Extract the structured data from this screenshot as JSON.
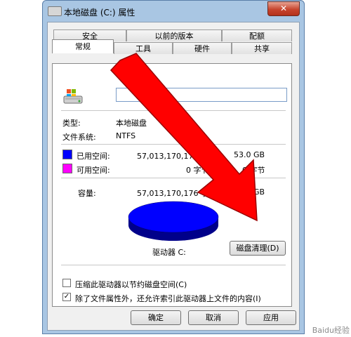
{
  "window": {
    "title": "本地磁盘 (C:) 属性",
    "close_glyph": "✕"
  },
  "tabs": {
    "row1": [
      "安全",
      "以前的版本",
      "配额"
    ],
    "row2": [
      "常规",
      "工具",
      "硬件",
      "共享"
    ]
  },
  "general": {
    "name_value": "",
    "type_label": "类型:",
    "type_value": "本地磁盘",
    "fs_label": "文件系统:",
    "fs_value": "NTFS",
    "used_label": "已用空间:",
    "used_bytes": "57,013,170,176 字节",
    "used_gb": "53.0 GB",
    "free_label": "可用空间:",
    "free_bytes": "0 字节",
    "free_gb": "0 字节",
    "capacity_label": "容量:",
    "capacity_bytes": "57,013,170,176 字节",
    "capacity_gb": "53.0 GB",
    "drive_label": "驱动器 C:",
    "cleanup_button": "磁盘清理(D)",
    "compress_label": "压缩此驱动器以节约磁盘空间(C)",
    "compress_checked": false,
    "index_label": "除了文件属性外，还允许索引此驱动器上文件的内容(I)",
    "index_checked": true
  },
  "colors": {
    "used": "#0000ff",
    "free": "#ff00ff",
    "arrow": "#ff0000"
  },
  "buttons": {
    "ok": "确定",
    "cancel": "取消",
    "apply": "应用"
  },
  "watermark": "Baidu经验"
}
